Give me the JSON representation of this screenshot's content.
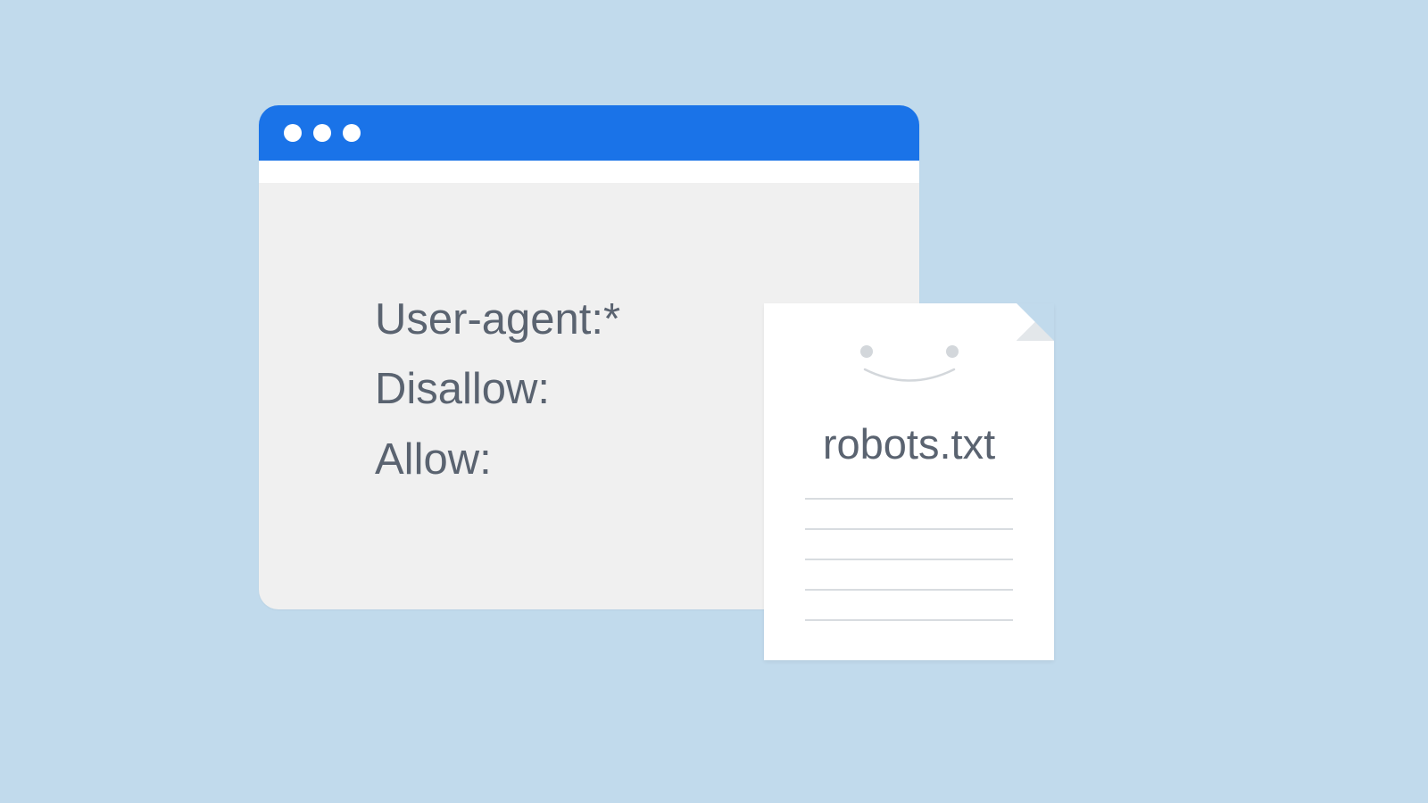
{
  "browser": {
    "content_lines": [
      "User-agent:*",
      "Disallow:",
      "Allow:"
    ]
  },
  "document": {
    "label": "robots.txt"
  }
}
